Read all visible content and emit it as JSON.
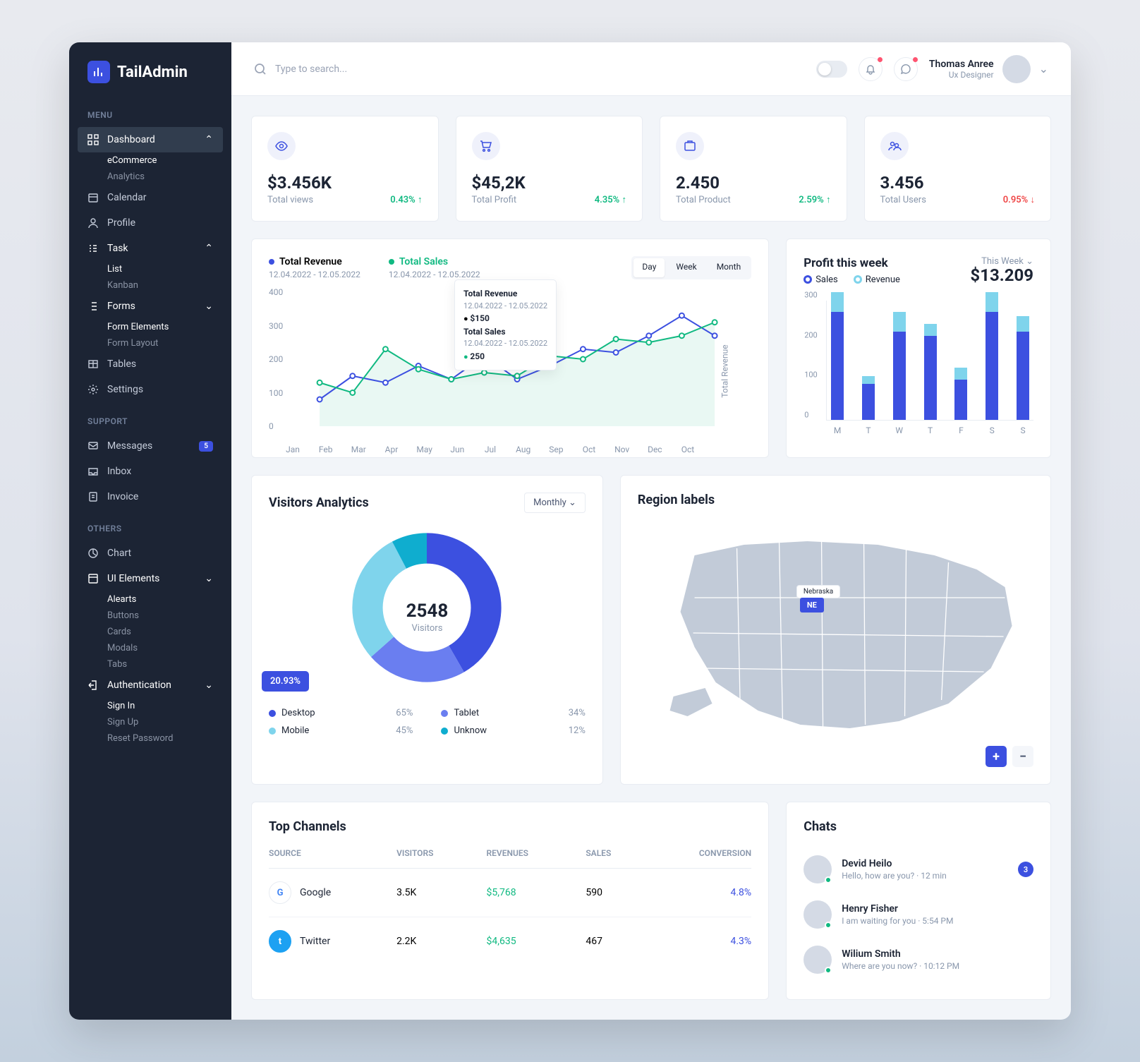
{
  "brand": "TailAdmin",
  "search": {
    "placeholder": "Type to search..."
  },
  "user": {
    "name": "Thomas Anree",
    "role": "Ux Designer"
  },
  "sidebar": {
    "menu_label": "MENU",
    "support_label": "SUPPORT",
    "others_label": "OTHERS",
    "dashboard": "Dashboard",
    "dashboard_sub": [
      "eCommerce",
      "Analytics"
    ],
    "calendar": "Calendar",
    "profile": "Profile",
    "task": "Task",
    "task_sub": [
      "List",
      "Kanban"
    ],
    "forms": "Forms",
    "forms_sub": [
      "Form Elements",
      "Form Layout"
    ],
    "tables": "Tables",
    "settings": "Settings",
    "messages": "Messages",
    "messages_badge": "5",
    "inbox": "Inbox",
    "invoice": "Invoice",
    "chart": "Chart",
    "uielements": "UI Elements",
    "ui_sub": [
      "Alearts",
      "Buttons",
      "Cards",
      "Modals",
      "Tabs"
    ],
    "auth": "Authentication",
    "auth_sub": [
      "Sign In",
      "Sign Up",
      "Reset Password"
    ]
  },
  "kpi": [
    {
      "value": "$3.456K",
      "label": "Total views",
      "delta": "0.43%",
      "dir": "up"
    },
    {
      "value": "$45,2K",
      "label": "Total Profit",
      "delta": "4.35%",
      "dir": "up"
    },
    {
      "value": "2.450",
      "label": "Total Product",
      "delta": "2.59%",
      "dir": "up"
    },
    {
      "value": "3.456",
      "label": "Total Users",
      "delta": "0.95%",
      "dir": "down"
    }
  ],
  "chart1": {
    "series": [
      {
        "name": "Total Revenue",
        "date": "12.04.2022 - 12.05.2022",
        "color": "#3c50e0"
      },
      {
        "name": "Total Sales",
        "date": "12.04.2022 - 12.05.2022",
        "color": "#10b981"
      }
    ],
    "ranges": [
      "Day",
      "Week",
      "Month"
    ],
    "range_active": "Day",
    "rot_label": "Total Revenue",
    "tooltip": {
      "t1": "Total Revenue",
      "t1d": "12.04.2022 - 12.05.2022",
      "t1v": "$150",
      "t2": "Total Sales",
      "t2d": "12.04.2022 - 12.05.2022",
      "t2v": "250"
    }
  },
  "chart2": {
    "title": "Profit this week",
    "dd": "This Week",
    "value": "$13.209",
    "series": [
      "Sales",
      "Revenue"
    ],
    "series_colors": [
      "#3c50e0",
      "#7fd4ec"
    ]
  },
  "visitors": {
    "title": "Visitors Analytics",
    "dd": "Monthly",
    "center_num": "2548",
    "center_lbl": "Visitors",
    "highlight_pct": "20.93%",
    "legend": [
      {
        "name": "Desktop",
        "pct": "65%",
        "color": "#3c50e0"
      },
      {
        "name": "Tablet",
        "pct": "34%",
        "color": "#6a7ef0"
      },
      {
        "name": "Mobile",
        "pct": "45%",
        "color": "#7fd4ec"
      },
      {
        "name": "Unknow",
        "pct": "12%",
        "color": "#0fadcf"
      }
    ]
  },
  "map": {
    "title": "Region labels",
    "highlight": "Nebraska",
    "highlight_short": "NE"
  },
  "topchannels": {
    "title": "Top Channels",
    "headers": [
      "SOURCE",
      "VISITORS",
      "REVENUES",
      "SALES",
      "CONVERSION"
    ],
    "rows": [
      {
        "source": "Google",
        "visitors": "3.5K",
        "revenue": "$5,768",
        "sales": "590",
        "conversion": "4.8%",
        "ico_bg": "#fff",
        "ico_border": "#e8ecf2",
        "ico_text": "G",
        "ico_color": "#4285f4"
      },
      {
        "source": "Twitter",
        "visitors": "2.2K",
        "revenue": "$4,635",
        "sales": "467",
        "conversion": "4.3%",
        "ico_bg": "#1da1f2",
        "ico_border": "#1da1f2",
        "ico_text": "t",
        "ico_color": "#fff"
      }
    ]
  },
  "chats": {
    "title": "Chats",
    "items": [
      {
        "name": "Devid Heilo",
        "msg": "Hello, how are you?",
        "time": "12 min",
        "badge": "3"
      },
      {
        "name": "Henry Fisher",
        "msg": "I am waiting for you",
        "time": "5:54 PM"
      },
      {
        "name": "Wilium Smith",
        "msg": "Where are you now?",
        "time": "10:12 PM"
      }
    ]
  },
  "chart_data": [
    {
      "type": "line",
      "title": "Total Revenue / Total Sales",
      "x": [
        "Jan",
        "Feb",
        "Mar",
        "Apr",
        "May",
        "Jun",
        "Jul",
        "Aug",
        "Sep",
        "Oct",
        "Nov",
        "Dec",
        "Oct"
      ],
      "ylim": [
        0,
        400
      ],
      "yticks": [
        0,
        100,
        200,
        300,
        400
      ],
      "series": [
        {
          "name": "Total Revenue",
          "color": "#3c50e0",
          "values": [
            80,
            150,
            130,
            180,
            140,
            210,
            140,
            180,
            230,
            220,
            270,
            330,
            270
          ]
        },
        {
          "name": "Total Sales",
          "color": "#10b981",
          "values": [
            130,
            100,
            230,
            170,
            140,
            160,
            150,
            210,
            200,
            260,
            250,
            270,
            310
          ]
        }
      ]
    },
    {
      "type": "bar",
      "title": "Profit this week",
      "categories": [
        "M",
        "T",
        "W",
        "T",
        "F",
        "S",
        "S"
      ],
      "ylim": [
        0,
        300
      ],
      "yticks": [
        0,
        100,
        200,
        300
      ],
      "series": [
        {
          "name": "Sales",
          "color": "#3c50e0",
          "values": [
            270,
            90,
            220,
            210,
            100,
            270,
            220
          ]
        },
        {
          "name": "Revenue",
          "color": "#7fd4ec",
          "values": [
            50,
            20,
            50,
            30,
            30,
            50,
            40
          ]
        }
      ]
    },
    {
      "type": "pie",
      "title": "Visitors Analytics",
      "categories": [
        "Desktop",
        "Tablet",
        "Mobile",
        "Unknow"
      ],
      "values": [
        65,
        34,
        45,
        12
      ],
      "colors": [
        "#3c50e0",
        "#6a7ef0",
        "#7fd4ec",
        "#0fadcf"
      ],
      "center_value": 2548
    }
  ]
}
